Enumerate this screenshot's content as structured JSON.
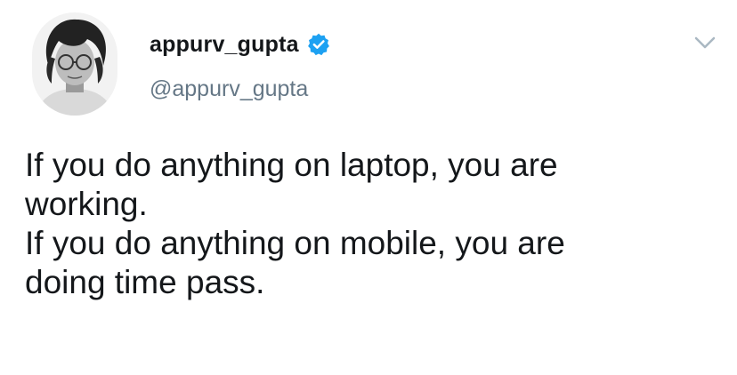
{
  "tweet": {
    "display_name": "appurv_gupta",
    "handle": "@appurv_gupta",
    "verified_icon": "verified-badge-icon",
    "menu_icon": "chevron-down-icon",
    "accent_color": "#1da1f2",
    "handle_color": "#657786",
    "text_lines": [
      "If you do anything on laptop, you are",
      "working.",
      "If you do anything on mobile, you are",
      "doing time pass."
    ]
  }
}
